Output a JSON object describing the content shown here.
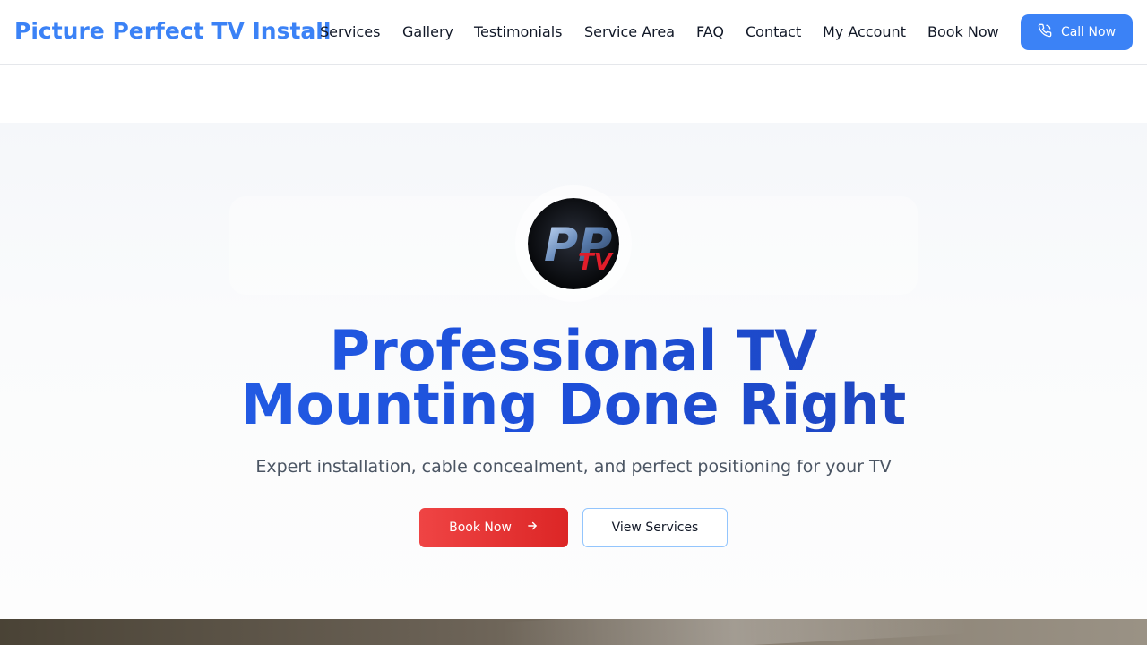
{
  "brand": {
    "name": "Picture Perfect TV Install",
    "color": "#3b82f6"
  },
  "nav": {
    "items": [
      {
        "label": "Services"
      },
      {
        "label": "Gallery"
      },
      {
        "label": "Testimonials"
      },
      {
        "label": "Service Area"
      },
      {
        "label": "FAQ"
      },
      {
        "label": "Contact"
      },
      {
        "label": "My Account"
      },
      {
        "label": "Book Now"
      }
    ],
    "call_button": {
      "label": "Call Now",
      "icon": "phone-icon"
    }
  },
  "hero": {
    "logo": {
      "letters": "PP",
      "accent_text": "TV"
    },
    "headline_line1": "Professional TV",
    "headline_line2": "Mounting Done Right",
    "subheadline": "Expert installation, cable concealment, and perfect positioning for your TV",
    "primary_button": {
      "label": "Book Now",
      "icon": "arrow-right-icon",
      "color": "#ef4444"
    },
    "secondary_button": {
      "label": "View Services"
    }
  },
  "colors": {
    "accent": "#3b82f6",
    "headline": "#1d4ed8",
    "cta": "#dc2626"
  }
}
